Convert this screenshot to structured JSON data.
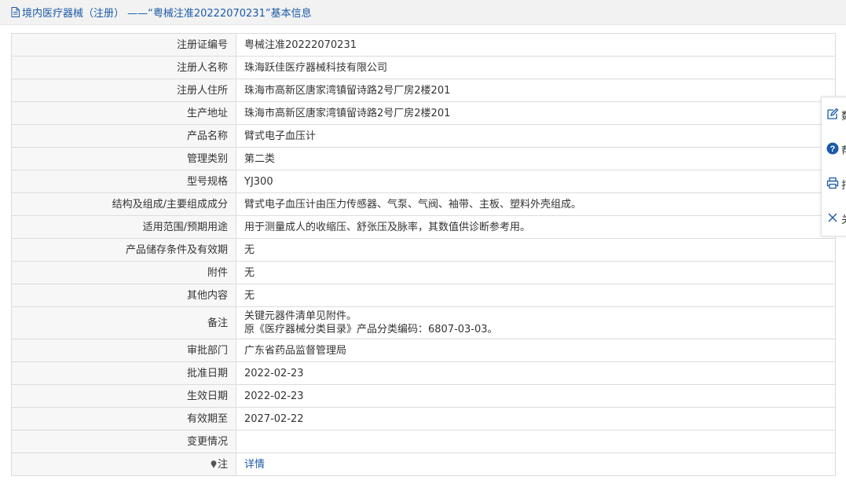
{
  "header": {
    "title": "境内医疗器械（注册） ——“粤械注准20222070231”基本信息"
  },
  "rows": [
    {
      "label": "注册证编号",
      "value": "粤械注准20222070231"
    },
    {
      "label": "注册人名称",
      "value": "珠海跃佳医疗器械科技有限公司"
    },
    {
      "label": "注册人住所",
      "value": "珠海市高新区唐家湾镇留诗路2号厂房2楼201"
    },
    {
      "label": "生产地址",
      "value": "珠海市高新区唐家湾镇留诗路2号厂房2楼201"
    },
    {
      "label": "产品名称",
      "value": "臂式电子血压计"
    },
    {
      "label": "管理类别",
      "value": "第二类"
    },
    {
      "label": "型号规格",
      "value": "YJ300"
    },
    {
      "label": "结构及组成/主要组成成分",
      "value": "臂式电子血压计由压力传感器、气泵、气阀、袖带、主板、塑料外壳组成。"
    },
    {
      "label": "适用范围/预期用途",
      "value": "用于测量成人的收缩压、舒张压及脉率，其数值供诊断参考用。"
    },
    {
      "label": "产品储存条件及有效期",
      "value": "无"
    },
    {
      "label": "附件",
      "value": "无"
    },
    {
      "label": "其他内容",
      "value": "无"
    }
  ],
  "remarks": {
    "label": "备注",
    "line1": "关键元器件清单见附件。",
    "line2": "原《医疗器械分类目录》产品分类编码：6807-03-03。"
  },
  "rows2": [
    {
      "label": "审批部门",
      "value": "广东省药品监督管理局"
    },
    {
      "label": "批准日期",
      "value": "2022-02-23"
    },
    {
      "label": "生效日期",
      "value": "2022-02-23"
    },
    {
      "label": "有效期至",
      "value": "2027-02-22"
    },
    {
      "label": "变更情况",
      "value": ""
    }
  ],
  "note": {
    "label": "注",
    "link": "详情"
  },
  "side_panel": {
    "items": [
      {
        "icon": "edit-icon",
        "text": "数"
      },
      {
        "icon": "help-icon",
        "text": "帮"
      },
      {
        "icon": "print-icon",
        "text": "打"
      },
      {
        "icon": "close-icon",
        "text": "关"
      }
    ]
  },
  "colors": {
    "link": "#1b5aa8",
    "help_icon": "#1b5aa8"
  }
}
